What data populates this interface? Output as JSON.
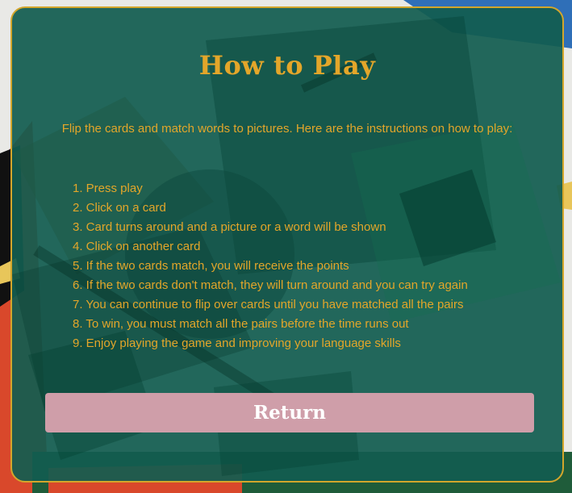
{
  "help": {
    "title": "How to Play",
    "intro": "Flip the cards and match words to pictures. Here are the instructions on how to play:",
    "steps": [
      "1. Press play",
      "2. Click on a card",
      "3. Card turns around and a picture or a word will be shown",
      "4. Click on another card",
      "5. If the two cards match, you will receive the points",
      "6. If the two cards don't match, they will turn around and you can try again",
      "7. You can continue to flip over cards until you have matched all the pairs",
      "8. To win, you must match all the pairs before the time runs out",
      "9. Enjoy playing the game and improving your language skills"
    ],
    "return_label": "Return"
  },
  "colors": {
    "panel": "#125c50",
    "accent": "#e3a62a",
    "border": "#d3a62b",
    "button": "#cf9ea9",
    "button_text": "#ffffff"
  }
}
